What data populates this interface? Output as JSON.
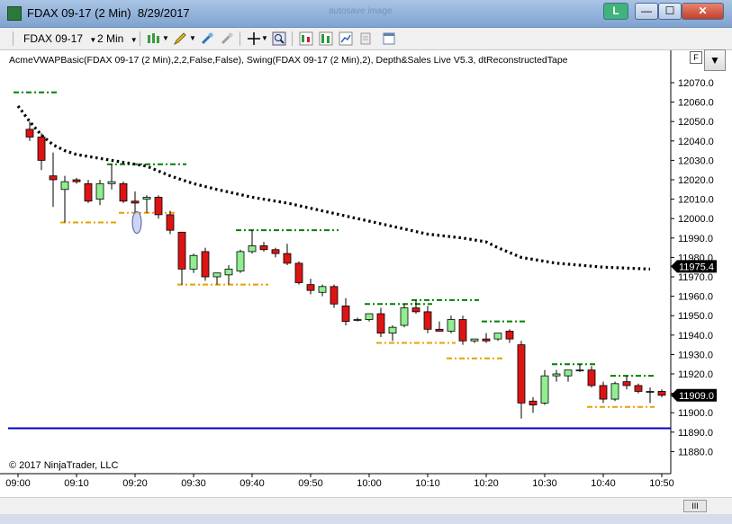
{
  "window": {
    "title": "FDAX 09-17 (2 Min)  8/29/2017",
    "ghost_text": "autosave image",
    "link_button": "L",
    "minimize_label": "—",
    "maximize_label": "☐",
    "close_label": "✕"
  },
  "toolbar": {
    "instrument": "FDAX 09-17",
    "interval": "2 Min"
  },
  "chart": {
    "indicator_label": "AcmeVWAPBasic(FDAX 09-17 (2 Min),2,2,False,False), Swing(FDAX 09-17 (2 Min),2), Depth&Sales Live V5.3, dtReconstructedTape",
    "copyright": "© 2017 NinjaTrader, LLC",
    "f_button": "F",
    "dropdown_label": "▼",
    "scroll_label": "III",
    "colors": {
      "up": "#90ee90",
      "down": "#dc1414",
      "vwap": "#000000",
      "swing_high": "#008000",
      "swing_low": "#e8a000",
      "hline": "#0000cc",
      "highlight": "#000000"
    }
  },
  "chart_data": {
    "type": "candlestick",
    "y_ticks": [
      "12070.0",
      "12060.0",
      "12050.0",
      "12040.0",
      "12030.0",
      "12020.0",
      "12010.0",
      "12000.0",
      "11990.0",
      "11980.0",
      "11970.0",
      "11960.0",
      "11950.0",
      "11940.0",
      "11930.0",
      "11920.0",
      "11910.0",
      "11900.0",
      "11890.0",
      "11880.0"
    ],
    "x_ticks": [
      "09:00",
      "09:10",
      "09:20",
      "09:30",
      "09:40",
      "09:50",
      "10:00",
      "10:10",
      "10:20",
      "10:30",
      "10:40",
      "10:50"
    ],
    "ylim": [
      11873,
      12079
    ],
    "price_labels": [
      {
        "text": "11975.4",
        "value": 11975.4
      },
      {
        "text": "11909.0",
        "value": 11909.0
      }
    ],
    "horizontal_line": 11892,
    "candles": [
      {
        "t": "09:02",
        "o": 12046,
        "h": 12050,
        "l": 12040,
        "c": 12042
      },
      {
        "t": "09:04",
        "o": 12042,
        "h": 12044,
        "l": 12025,
        "c": 12030
      },
      {
        "t": "09:06",
        "o": 12022,
        "h": 12034,
        "l": 12006,
        "c": 12020
      },
      {
        "t": "09:08",
        "o": 12015,
        "h": 12022,
        "l": 11998,
        "c": 12019
      },
      {
        "t": "09:10",
        "o": 12020,
        "h": 12021,
        "l": 12018,
        "c": 12019
      },
      {
        "t": "09:12",
        "o": 12018,
        "h": 12020,
        "l": 12008,
        "c": 12009
      },
      {
        "t": "09:14",
        "o": 12010,
        "h": 12020,
        "l": 12007,
        "c": 12018
      },
      {
        "t": "09:16",
        "o": 12018,
        "h": 12028,
        "l": 12015,
        "c": 12019
      },
      {
        "t": "09:18",
        "o": 12018,
        "h": 12019,
        "l": 12008,
        "c": 12009
      },
      {
        "t": "09:20",
        "o": 12009,
        "h": 12014,
        "l": 12003,
        "c": 12008
      },
      {
        "t": "09:22",
        "o": 12010,
        "h": 12012,
        "l": 12003,
        "c": 12011
      },
      {
        "t": "09:24",
        "o": 12011,
        "h": 12012,
        "l": 12000,
        "c": 12002
      },
      {
        "t": "09:26",
        "o": 12002,
        "h": 12004,
        "l": 11992,
        "c": 11994
      },
      {
        "t": "09:28",
        "o": 11993,
        "h": 11993,
        "l": 11966,
        "c": 11974
      },
      {
        "t": "09:30",
        "o": 11974,
        "h": 11982,
        "l": 11972,
        "c": 11981
      },
      {
        "t": "09:32",
        "o": 11983,
        "h": 11985,
        "l": 11968,
        "c": 11970
      },
      {
        "t": "09:34",
        "o": 11970,
        "h": 11972,
        "l": 11966,
        "c": 11972
      },
      {
        "t": "09:36",
        "o": 11971,
        "h": 11976,
        "l": 11966,
        "c": 11974
      },
      {
        "t": "09:38",
        "o": 11973,
        "h": 11984,
        "l": 11972,
        "c": 11983
      },
      {
        "t": "09:40",
        "o": 11983,
        "h": 11994,
        "l": 11982,
        "c": 11986
      },
      {
        "t": "09:42",
        "o": 11986,
        "h": 11988,
        "l": 11983,
        "c": 11984
      },
      {
        "t": "09:44",
        "o": 11984,
        "h": 11985,
        "l": 11980,
        "c": 11982
      },
      {
        "t": "09:46",
        "o": 11982,
        "h": 11987,
        "l": 11976,
        "c": 11977
      },
      {
        "t": "09:48",
        "o": 11977,
        "h": 11978,
        "l": 11966,
        "c": 11967
      },
      {
        "t": "09:50",
        "o": 11966,
        "h": 11969,
        "l": 11961,
        "c": 11963
      },
      {
        "t": "09:52",
        "o": 11962,
        "h": 11966,
        "l": 11960,
        "c": 11965
      },
      {
        "t": "09:54",
        "o": 11965,
        "h": 11966,
        "l": 11954,
        "c": 11956
      },
      {
        "t": "09:56",
        "o": 11955,
        "h": 11959,
        "l": 11945,
        "c": 11947
      },
      {
        "t": "09:58",
        "o": 11948,
        "h": 11949,
        "l": 11947,
        "c": 11948
      },
      {
        "t": "10:00",
        "o": 11948,
        "h": 11951,
        "l": 11947,
        "c": 11951
      },
      {
        "t": "10:02",
        "o": 11951,
        "h": 11954,
        "l": 11939,
        "c": 11941
      },
      {
        "t": "10:04",
        "o": 11941,
        "h": 11945,
        "l": 11937,
        "c": 11944
      },
      {
        "t": "10:06",
        "o": 11945,
        "h": 11956,
        "l": 11944,
        "c": 11954
      },
      {
        "t": "10:08",
        "o": 11954,
        "h": 11958,
        "l": 11951,
        "c": 11952
      },
      {
        "t": "10:10",
        "o": 11952,
        "h": 11955,
        "l": 11941,
        "c": 11943
      },
      {
        "t": "10:12",
        "o": 11943,
        "h": 11947,
        "l": 11942,
        "c": 11942
      },
      {
        "t": "10:14",
        "o": 11942,
        "h": 11950,
        "l": 11941,
        "c": 11948
      },
      {
        "t": "10:16",
        "o": 11948,
        "h": 11950,
        "l": 11935,
        "c": 11937
      },
      {
        "t": "10:18",
        "o": 11937,
        "h": 11938,
        "l": 11936,
        "c": 11938
      },
      {
        "t": "10:20",
        "o": 11938,
        "h": 11941,
        "l": 11936,
        "c": 11937
      },
      {
        "t": "10:22",
        "o": 11938,
        "h": 11941,
        "l": 11937,
        "c": 11941
      },
      {
        "t": "10:24",
        "o": 11942,
        "h": 11943,
        "l": 11936,
        "c": 11938
      },
      {
        "t": "10:26",
        "o": 11935,
        "h": 11937,
        "l": 11897,
        "c": 11905
      },
      {
        "t": "10:28",
        "o": 11906,
        "h": 11908,
        "l": 11900,
        "c": 11904
      },
      {
        "t": "10:30",
        "o": 11905,
        "h": 11922,
        "l": 11904,
        "c": 11919
      },
      {
        "t": "10:32",
        "o": 11919,
        "h": 11922,
        "l": 11916,
        "c": 11920
      },
      {
        "t": "10:34",
        "o": 11919,
        "h": 11922,
        "l": 11916,
        "c": 11922
      },
      {
        "t": "10:36",
        "o": 11922,
        "h": 11925,
        "l": 11921,
        "c": 11922
      },
      {
        "t": "10:38",
        "o": 11922,
        "h": 11924,
        "l": 11913,
        "c": 11914
      },
      {
        "t": "10:40",
        "o": 11914,
        "h": 11916,
        "l": 11905,
        "c": 11907
      },
      {
        "t": "10:42",
        "o": 11907,
        "h": 11916,
        "l": 11906,
        "c": 11915
      },
      {
        "t": "10:44",
        "o": 11916,
        "h": 11919,
        "l": 11912,
        "c": 11914
      },
      {
        "t": "10:46",
        "o": 11914,
        "h": 11915,
        "l": 11910,
        "c": 11911
      },
      {
        "t": "10:48",
        "o": 11911,
        "h": 11913,
        "l": 11905,
        "c": 11911
      },
      {
        "t": "10:50",
        "o": 11911,
        "h": 11912,
        "l": 11908,
        "c": 11909
      }
    ],
    "vwap": [
      {
        "t": "09:00",
        "v": 12058
      },
      {
        "t": "09:02",
        "v": 12050
      },
      {
        "t": "09:04",
        "v": 12043
      },
      {
        "t": "09:06",
        "v": 12038
      },
      {
        "t": "09:08",
        "v": 12035
      },
      {
        "t": "09:10",
        "v": 12033
      },
      {
        "t": "09:14",
        "v": 12031
      },
      {
        "t": "09:18",
        "v": 12029
      },
      {
        "t": "09:22",
        "v": 12027
      },
      {
        "t": "09:26",
        "v": 12022
      },
      {
        "t": "09:30",
        "v": 12018
      },
      {
        "t": "09:34",
        "v": 12015
      },
      {
        "t": "09:40",
        "v": 12011
      },
      {
        "t": "09:46",
        "v": 12008
      },
      {
        "t": "09:52",
        "v": 12004
      },
      {
        "t": "09:58",
        "v": 12000
      },
      {
        "t": "10:04",
        "v": 11996
      },
      {
        "t": "10:10",
        "v": 11992
      },
      {
        "t": "10:16",
        "v": 11990
      },
      {
        "t": "10:20",
        "v": 11988
      },
      {
        "t": "10:22",
        "v": 11985
      },
      {
        "t": "10:26",
        "v": 11980
      },
      {
        "t": "10:32",
        "v": 11977
      },
      {
        "t": "10:40",
        "v": 11975
      },
      {
        "t": "10:48",
        "v": 11974
      }
    ],
    "swing_levels": [
      {
        "kind": "high",
        "from": "09:00",
        "to": "09:06",
        "price": 12065
      },
      {
        "kind": "high",
        "from": "09:16",
        "to": "09:28",
        "price": 12028
      },
      {
        "kind": "low",
        "from": "09:08",
        "to": "09:16",
        "price": 11998
      },
      {
        "kind": "low",
        "from": "09:18",
        "to": "09:26",
        "price": 12003
      },
      {
        "kind": "high",
        "from": "09:38",
        "to": "09:54",
        "price": 11994
      },
      {
        "kind": "low",
        "from": "09:28",
        "to": "09:42",
        "price": 11966
      },
      {
        "kind": "high",
        "from": "10:00",
        "to": "10:10",
        "price": 11956
      },
      {
        "kind": "high",
        "from": "10:08",
        "to": "10:18",
        "price": 11958
      },
      {
        "kind": "low",
        "from": "10:02",
        "to": "10:14",
        "price": 11936
      },
      {
        "kind": "low",
        "from": "10:14",
        "to": "10:22",
        "price": 11928
      },
      {
        "kind": "high",
        "from": "10:20",
        "to": "10:26",
        "price": 11947
      },
      {
        "kind": "high",
        "from": "10:32",
        "to": "10:38",
        "price": 11925
      },
      {
        "kind": "high",
        "from": "10:42",
        "to": "10:48",
        "price": 11919
      },
      {
        "kind": "low",
        "from": "10:38",
        "to": "10:48",
        "price": 11903
      }
    ],
    "highlight": {
      "t": "09:20",
      "price": 11998
    },
    "grid": false
  }
}
